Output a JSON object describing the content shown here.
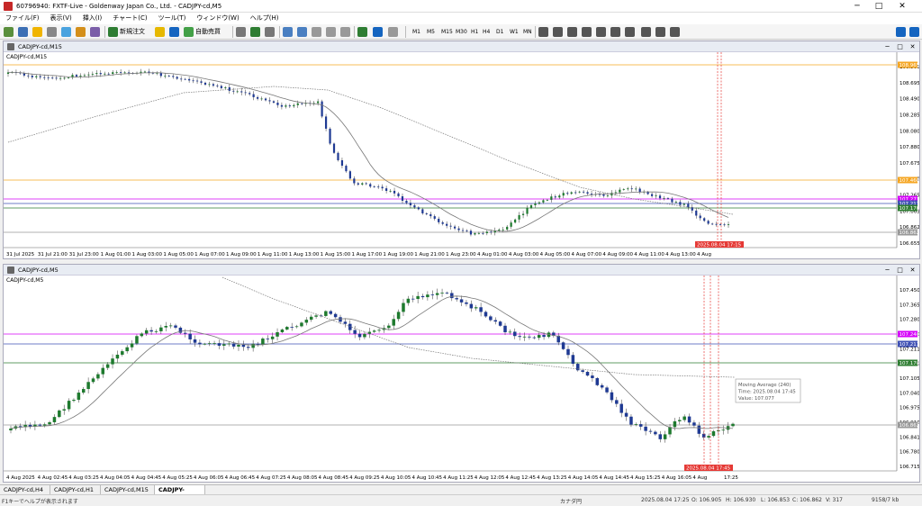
{
  "window": {
    "title": "60796940: FXTF-Live - Goldenway Japan Co., Ltd. - CADJPY-cd,M5",
    "minimize": "─",
    "maximize": "□",
    "close": "✕"
  },
  "menu": [
    "ファイル(F)",
    "表示(V)",
    "挿入(I)",
    "チャート(C)",
    "ツール(T)",
    "ウィンドウ(W)",
    "ヘルプ(H)"
  ],
  "toolbar": {
    "new_order": "新規注文",
    "auto_trade": "自動売買",
    "timeframes": [
      "M1",
      "M5",
      "M15",
      "M30",
      "H1",
      "H4",
      "D1",
      "W1",
      "MN"
    ]
  },
  "colors": {
    "bull": "#1e7a2e",
    "bear": "#1f3a93",
    "ma_fast": "#777777",
    "ma_slow": "#777777",
    "orange": "#f5a623",
    "magenta": "#d500f9",
    "blue": "#3f51b5",
    "green": "#2e7d32",
    "red": "#e53935",
    "bid": "#999999"
  },
  "top": {
    "window_title": "CADJPY-cd,M15",
    "symbol": "CADJPY-cd,M15",
    "yticks": [
      "106.900",
      "108.695",
      "108.490",
      "108.285",
      "108.080",
      "107.880",
      "107.675",
      "107.470",
      "107.265",
      "107.063",
      "106.862",
      "106.655"
    ],
    "hlines": [
      {
        "label": "108.965",
        "color": "#f5a623"
      },
      {
        "label": "107.460",
        "color": "#f5a623"
      },
      {
        "label": "107.271",
        "color": "#d500f9"
      },
      {
        "label": "107.211",
        "color": "#3f51b5"
      },
      {
        "label": "107.170",
        "color": "#2e7d32"
      },
      {
        "label": "106.862",
        "color": "#999999"
      }
    ],
    "xticks": [
      "31 Jul 2025",
      "31 Jul 21:00",
      "31 Jul 23:00",
      "1 Aug 01:00",
      "1 Aug 03:00",
      "1 Aug 05:00",
      "1 Aug 07:00",
      "1 Aug 09:00",
      "1 Aug 11:00",
      "1 Aug 13:00",
      "1 Aug 15:00",
      "1 Aug 17:00",
      "1 Aug 19:00",
      "1 Aug 21:00",
      "1 Aug 23:00",
      "4 Aug 01:00",
      "4 Aug 03:00",
      "4 Aug 05:00",
      "4 Aug 07:00",
      "4 Aug 09:00",
      "4 Aug 11:00",
      "4 Aug 13:00",
      "4 Aug"
    ],
    "time_marker": "2025.08.04 17:15"
  },
  "bottom": {
    "window_title": "CADJPY-cd,M5",
    "symbol": "CADJPY-cd,M5",
    "yticks": [
      "107.450",
      "107.365",
      "107.280",
      "107.240",
      "107.211",
      "107.170",
      "107.105",
      "107.040",
      "106.975",
      "106.910",
      "106.841",
      "106.780",
      "106.715"
    ],
    "hlines": [
      {
        "label": "107.240",
        "color": "#d500f9"
      },
      {
        "label": "107.211",
        "color": "#3f51b5"
      },
      {
        "label": "107.170",
        "color": "#2e7d32"
      },
      {
        "label": "106.862",
        "color": "#999999"
      }
    ],
    "xticks": [
      "4 Aug 2025",
      "4 Aug 02:45",
      "4 Aug 03:25",
      "4 Aug 04:05",
      "4 Aug 04:45",
      "4 Aug 05:25",
      "4 Aug 06:05",
      "4 Aug 06:45",
      "4 Aug 07:25",
      "4 Aug 08:05",
      "4 Aug 08:45",
      "4 Aug 09:25",
      "4 Aug 10:05",
      "4 Aug 10:45",
      "4 Aug 11:25",
      "4 Aug 12:05",
      "4 Aug 12:45",
      "4 Aug 13:25",
      "4 Aug 14:05",
      "4 Aug 14:45",
      "4 Aug 15:25",
      "4 Aug 16:05",
      "4 Aug",
      "17:25"
    ],
    "time_marker": "2025.08.04 17:45",
    "tooltip": {
      "line1": "Moving Average (240)",
      "line2": "Time: 2025.08.04 17:45",
      "line3": "Value: 107.077"
    }
  },
  "tabs": [
    "CADJPY-cd,H4",
    "CADJPY-cd,H1",
    "CADJPY-cd,M15",
    "CADJPY-cd,M5"
  ],
  "status": {
    "help": "F1キーでヘルプが表示されます",
    "profile": "カナダ円",
    "time": "2025.08.04 17:25",
    "o": "O: 106.905",
    "h": "H: 106.930",
    "l": "L: 106.853",
    "c": "C: 106.862",
    "v": "V: 317",
    "kb": "9158/7 kb"
  }
}
